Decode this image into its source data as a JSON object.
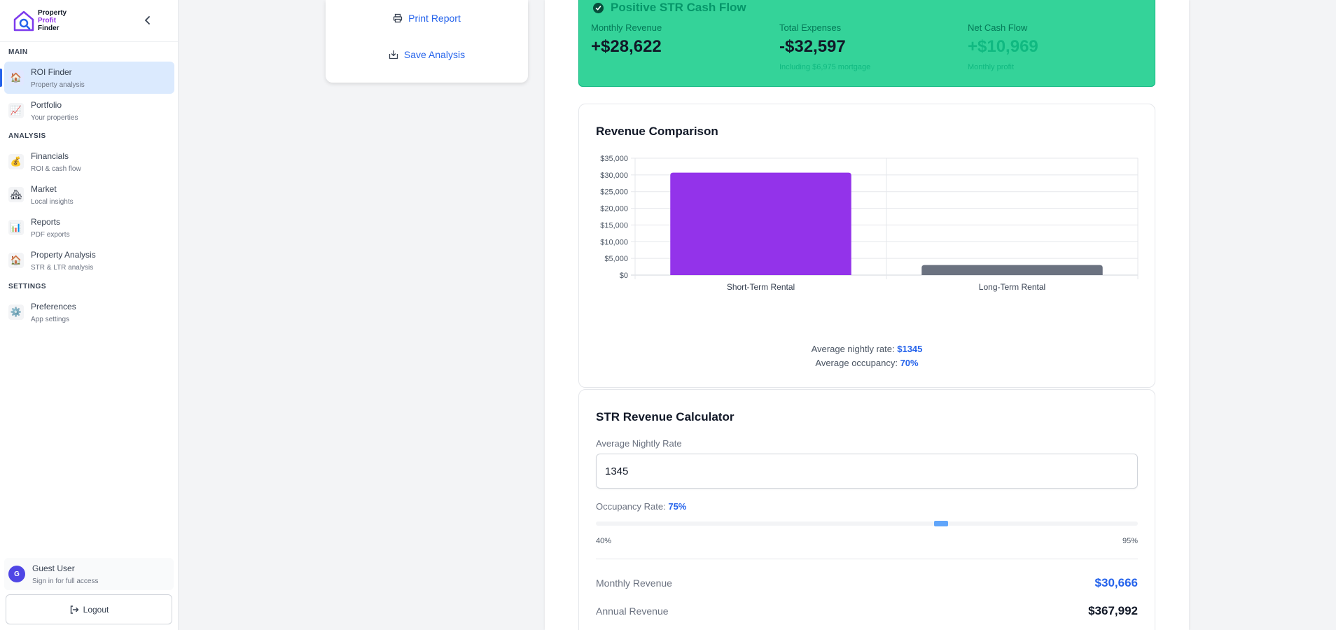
{
  "brand": {
    "line1": "Property",
    "line2": "Profit",
    "line3": "Finder"
  },
  "sidebar": {
    "sections": [
      {
        "label": "MAIN",
        "items": [
          {
            "title": "ROI Finder",
            "subtitle": "Property analysis",
            "icon": "house-icon",
            "glyph": "🏠",
            "active": true
          },
          {
            "title": "Portfolio",
            "subtitle": "Your properties",
            "icon": "chart-up-icon",
            "glyph": "📈"
          }
        ]
      },
      {
        "label": "ANALYSIS",
        "items": [
          {
            "title": "Financials",
            "subtitle": "ROI & cash flow",
            "icon": "money-bag-icon",
            "glyph": "💰"
          },
          {
            "title": "Market",
            "subtitle": "Local insights",
            "icon": "houses-icon",
            "glyph": "🏘"
          },
          {
            "title": "Reports",
            "subtitle": "PDF exports",
            "icon": "bar-chart-icon",
            "glyph": "📊"
          },
          {
            "title": "Property Analysis",
            "subtitle": "STR & LTR analysis",
            "icon": "house-icon",
            "glyph": "🏠"
          }
        ]
      },
      {
        "label": "SETTINGS",
        "items": [
          {
            "title": "Preferences",
            "subtitle": "App settings",
            "icon": "gear-icon",
            "glyph": "⚙️"
          }
        ]
      }
    ],
    "user": {
      "initial": "G",
      "name": "Guest User",
      "subtitle": "Sign in for full access"
    },
    "logout_label": "Logout"
  },
  "actions": {
    "print_label": "Print Report",
    "save_label": "Save Analysis"
  },
  "cash_flow": {
    "title": "Positive STR Cash Flow",
    "colors": {
      "card": "#34d399",
      "positive": "#10b981",
      "negative": "#111827"
    },
    "metrics": [
      {
        "label": "Monthly Revenue",
        "value": "+$28,622",
        "sub": ""
      },
      {
        "label": "Total Expenses",
        "value": "-$32,597",
        "sub": "Including $6,975 mortgage"
      },
      {
        "label": "Net Cash Flow",
        "value": "+$10,969",
        "sub": "Monthly profit"
      }
    ]
  },
  "revenue_chart": {
    "title": "Revenue Comparison",
    "nightly_rate_label": "Average nightly rate:",
    "nightly_rate_value": "$1345",
    "occupancy_label": "Average occupancy:",
    "occupancy_value": "70%"
  },
  "chart_data": {
    "type": "bar",
    "categories": [
      "Short-Term Rental",
      "Long-Term Rental"
    ],
    "values": [
      30666,
      3000
    ],
    "colors": [
      "#9333ea",
      "#6b7280"
    ],
    "ylim": [
      0,
      35000
    ],
    "yticks": [
      0,
      5000,
      10000,
      15000,
      20000,
      25000,
      30000,
      35000
    ],
    "ytick_labels": [
      "$0",
      "$5,000",
      "$10,000",
      "$15,000",
      "$20,000",
      "$25,000",
      "$30,000",
      "$35,000"
    ],
    "grid": true
  },
  "calculator": {
    "title": "STR Revenue Calculator",
    "nightly_rate_label": "Average Nightly Rate",
    "nightly_rate_value": "1345",
    "occupancy_label": "Occupancy Rate:",
    "occupancy_value": "75%",
    "occupancy_fraction": 0.6364,
    "slider_min": "40%",
    "slider_max": "95%",
    "monthly_label": "Monthly Revenue",
    "monthly_value": "$30,666",
    "annual_label": "Annual Revenue",
    "annual_value": "$367,992",
    "colors": {
      "accent": "#2563eb"
    }
  }
}
